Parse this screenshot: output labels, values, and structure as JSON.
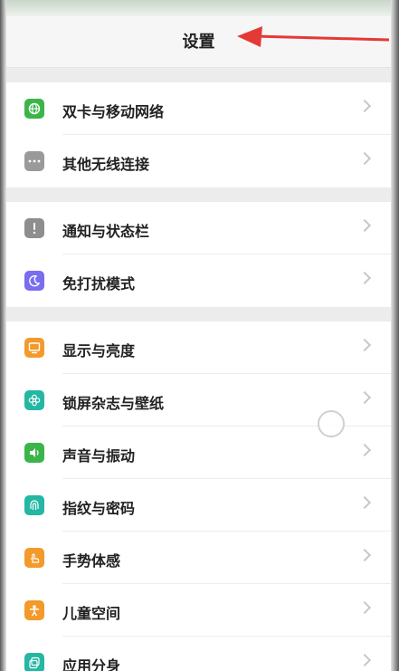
{
  "header": {
    "title": "设置"
  },
  "colors": {
    "green": "#3bb54a",
    "gray": "#8e8e8e",
    "purple": "#7a6df0",
    "orange": "#f39a2b",
    "teal": "#24b7a4",
    "arrow": "#e53935"
  },
  "groups": [
    {
      "items": [
        {
          "label": "双卡与移动网络",
          "icon": "globe-icon",
          "color": "#3bb54a"
        },
        {
          "label": "其他无线连接",
          "icon": "more-dots-icon",
          "color": "#9a9a9a"
        }
      ]
    },
    {
      "items": [
        {
          "label": "通知与状态栏",
          "icon": "exclamation-icon",
          "color": "#8e8e8e"
        },
        {
          "label": "免打扰模式",
          "icon": "moon-icon",
          "color": "#7a6df0"
        }
      ]
    },
    {
      "items": [
        {
          "label": "显示与亮度",
          "icon": "display-icon",
          "color": "#f39a2b"
        },
        {
          "label": "锁屏杂志与壁纸",
          "icon": "flower-icon",
          "color": "#24b7a4"
        },
        {
          "label": "声音与振动",
          "icon": "speaker-icon",
          "color": "#3bb54a"
        },
        {
          "label": "指纹与密码",
          "icon": "fingerprint-icon",
          "color": "#24b7a4"
        },
        {
          "label": "手势体感",
          "icon": "hand-icon",
          "color": "#f39a2b"
        },
        {
          "label": "儿童空间",
          "icon": "child-icon",
          "color": "#f39a2b"
        },
        {
          "label": "应用分身",
          "icon": "app-clone-icon",
          "color": "#24b7a4"
        }
      ]
    }
  ]
}
